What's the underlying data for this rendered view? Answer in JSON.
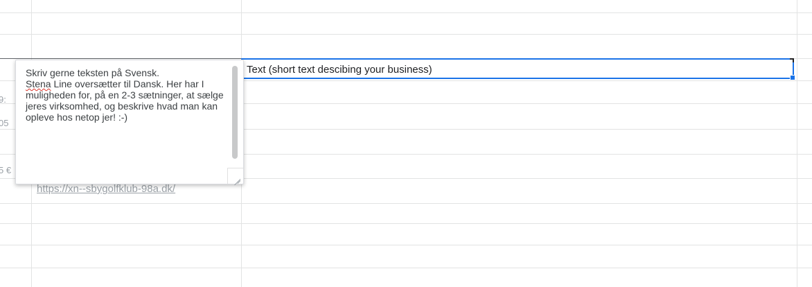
{
  "cells": {
    "selected_cell_text": "Text (short text descibing your business)",
    "link_text": "https://xn--sbygolfklub-98a.dk/",
    "row_number_fragments": [
      "9:",
      "05",
      "5 €"
    ]
  },
  "note": {
    "text_before_spell": "Skriv gerne teksten på Svensk.",
    "spell_word": "Stena",
    "text_after_spell": " Line oversætter til Dansk. Her har I muligheden for, på en 2-3 sætninger, at sælge jeres virksomhed, og beskrive hvad man kan opleve hos netop jer! :-)"
  },
  "colors": {
    "selection": "#1a73e8",
    "gridline": "#e2e3e3",
    "spellcheck": "#d93025"
  },
  "icons": [
    "resize-grip-icon"
  ]
}
